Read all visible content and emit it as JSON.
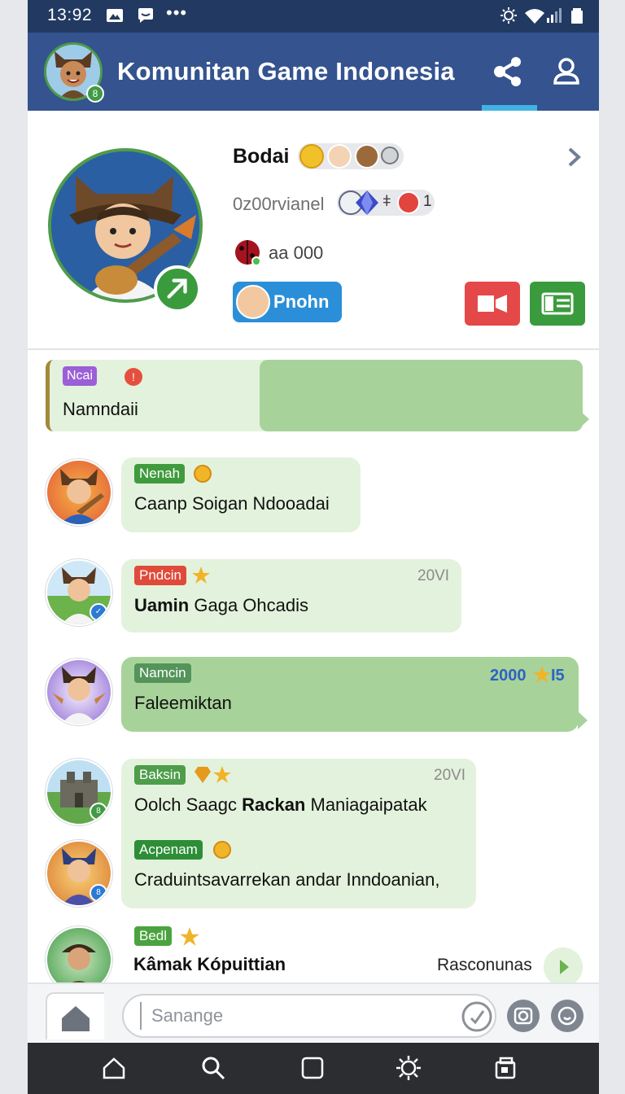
{
  "status_bar": {
    "time": "13:92",
    "more": "•••"
  },
  "app_bar": {
    "title": "Komunitan Game Indonesia",
    "avatar_badge": "8"
  },
  "profile": {
    "name": "Bodai",
    "subtitle": "0z00rvianel",
    "badge_text": "1",
    "points": "aa 000",
    "follow_label": "Pnohn"
  },
  "pinned": {
    "tag": "Ncai",
    "message": "Namndaii"
  },
  "messages": [
    {
      "tag": "Nenah",
      "text": "Caanp Soigan Ndooadai",
      "time": ""
    },
    {
      "tag": "Pndcin",
      "text_bold": "Uamin",
      "text": "Gaga Ohcadis",
      "time": "20VI"
    },
    {
      "tag": "Namcin",
      "text": "Faleemiktan",
      "count_a": "2000",
      "count_b": "I5"
    },
    {
      "tag": "Baksin",
      "text": "Oolch Saagc",
      "text_bold": "Rackan",
      "text_tail": "Maniagaipatak",
      "time": "20VI"
    },
    {
      "tag": "Acpenam",
      "text": "Craduintsavarrekan andar Inndoanian,"
    },
    {
      "tag": "Bedl",
      "author": "Kâmak Kópuittian",
      "sub": "Rasconunas"
    }
  ],
  "input": {
    "placeholder": "Sanange"
  },
  "colors": {
    "header": "#34538f",
    "status": "#223a62",
    "bubble_light": "#e3f2dc",
    "bubble_dark": "#a7d39a",
    "accent_blue": "#2a8fd8",
    "accent_red": "#e54848",
    "accent_green": "#3a9b3d"
  },
  "icons": [
    "share-icon",
    "profile-icon",
    "home-icon",
    "search-icon",
    "square-icon",
    "settings-icon",
    "gallery-icon",
    "camera-icon",
    "emoji-icon",
    "attach-icon"
  ]
}
